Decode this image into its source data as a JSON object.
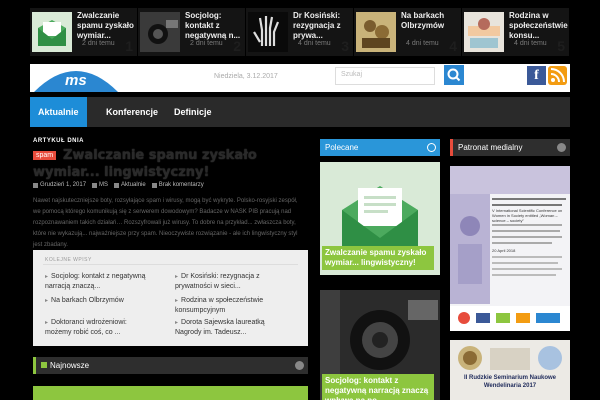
{
  "ticker": [
    {
      "title": "Zwalczanie spamu zyskało wymiar...",
      "date": "2 dni temu",
      "num": "1"
    },
    {
      "title": "Socjolog: kontakt z negatywną n...",
      "date": "2 dni temu",
      "num": "2"
    },
    {
      "title": "Dr Kosiński: rezygnacja z prywa...",
      "date": "4 dni temu",
      "num": "3"
    },
    {
      "title": "Na barkach Olbrzymów",
      "date": "4 dni temu",
      "num": "4"
    },
    {
      "title": "Rodzina w społeczeństwie konsu...",
      "date": "4 dni temu",
      "num": "5"
    }
  ],
  "header": {
    "logo": "ms",
    "date": "Niedziela, 3.12.2017",
    "search_placeholder": "Szukaj"
  },
  "nav": [
    "Aktualnie",
    "Konferencje",
    "Definicje"
  ],
  "article": {
    "category": "ARTYKUŁ DNIA",
    "badge": "spam",
    "title": "Zwalczanie spamu zyskało wymiar... lingwistyczny!",
    "date": "Grudzień 1, 2017",
    "author": "MS",
    "section": "Aktualnie",
    "comments": "Brak komentarzy",
    "excerpt": "Nawet najskuteczniejsze boty, rozsyłające spam i wirusy, mogą być wykryte. Polsko-rosyjski zespół, we pomocą którego komunikują się z serwerem dowodowym? Badacze w NASK PIB pracują nad rozpoznawaniem takich działań… Rozszyfrowali już wirusy. To dobre na przykład... zwłaszcza boty, które nie wykazują... najważniejsze przy spam. Nieoczywiste rozwiązanie - ale ich lingwistyczny styl jest zbadany."
  },
  "related": {
    "heading": "KOLEJNE WPISY",
    "items": [
      "Socjolog: kontakt z negatywną narracją znaczą...",
      "Dr Kosiński: rezygnacja z prywatności w sieci...",
      "Na barkach Olbrzymów",
      "Rodzina w społeczeństwie konsumpcyjnym",
      "Doktoranci wdrożeniowi: możemy robić coś, co ...",
      "Dorota Sajewska laureatką Nagrody im. Tadeusz..."
    ]
  },
  "latest": {
    "label": "Najnowsze"
  },
  "polecane": {
    "label": "Polecane",
    "items": [
      "Zwalczanie spamu zyskało wymiar... lingwistyczny!",
      "Socjolog: kontakt z negatywną narracją znaczą wpływa na po..."
    ]
  },
  "patronat": {
    "label": "Patronat medialny",
    "poster1_title": "V International Scientific Conference on Women in Society entitled „Woman – science – society”",
    "poster1_date": "20 April 2018",
    "poster2_title": "II Rudzkie Seminarium Naukowe Wendelinaria 2017"
  },
  "colors": {
    "accent_blue": "#1d8dd8",
    "green": "#8dc63f",
    "red": "#e74c3c"
  }
}
